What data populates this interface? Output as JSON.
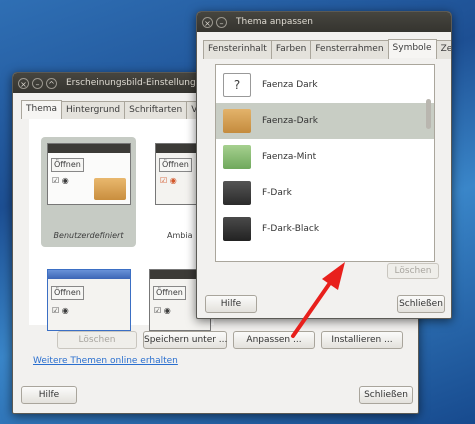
{
  "back_window": {
    "title": "Erscheinungsbild-Einstellungen",
    "tabs": [
      "Thema",
      "Hintergrund",
      "Schriftarten",
      "Visue"
    ],
    "themes": [
      {
        "label": "Benutzerdefiniert",
        "button": "Öffnen"
      },
      {
        "label": "Ambia",
        "button": "Öffnen"
      },
      {
        "label": "",
        "button": "Öffnen"
      },
      {
        "label": "",
        "button": "Öffnen"
      }
    ],
    "buttons": {
      "delete": "Löschen",
      "save": "Speichern unter ...",
      "customize": "Anpassen ...",
      "install": "Installieren ..."
    },
    "link": "Weitere Themen online erhalten",
    "help": "Hilfe",
    "close": "Schließen"
  },
  "front_window": {
    "title": "Thema anpassen",
    "tabs": [
      "Fensterinhalt",
      "Farben",
      "Fensterrahmen",
      "Symbole",
      "Zeiger"
    ],
    "active_tab": "Symbole",
    "icon_themes": [
      {
        "label": "Faenza Dark",
        "icon": "question-icon",
        "color": "#ffffff"
      },
      {
        "label": "Faenza-Dark",
        "icon": "folder-icon",
        "color": "#d9a55a"
      },
      {
        "label": "Faenza-Mint",
        "icon": "folder-icon",
        "color": "#8fc07a"
      },
      {
        "label": "F-Dark",
        "icon": "folder-icon",
        "color": "#3a3a3a"
      },
      {
        "label": "F-Dark-Black",
        "icon": "folder-icon",
        "color": "#2e2e2e"
      }
    ],
    "selected_index": 1,
    "delete": "Löschen",
    "help": "Hilfe",
    "close": "Schließen"
  },
  "annotation": {
    "arrow_color": "#e8201c"
  }
}
